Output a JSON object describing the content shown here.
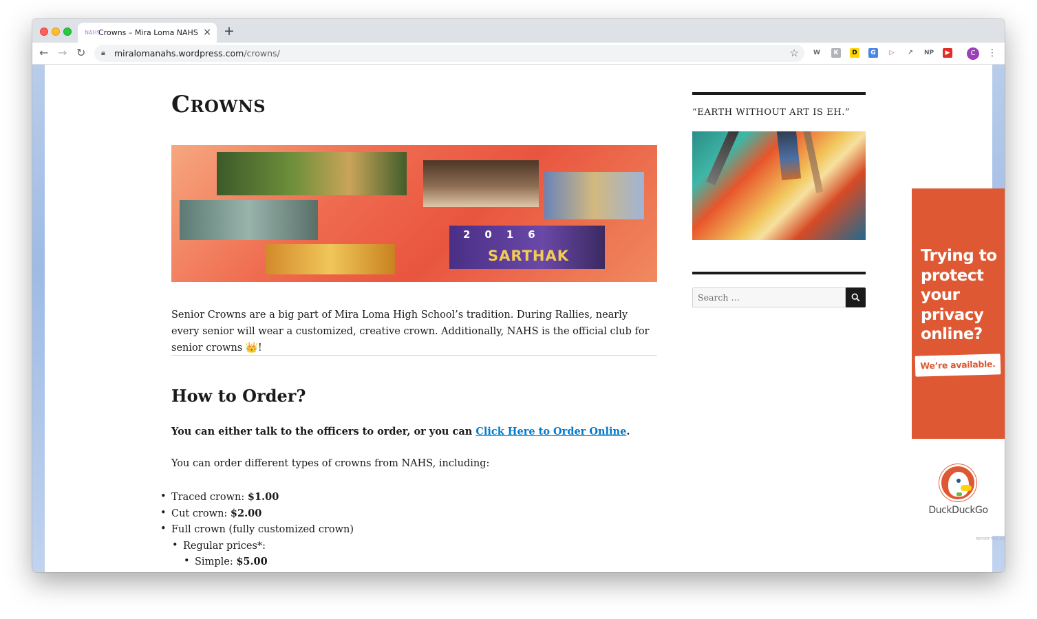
{
  "browser": {
    "tab_title": "Crowns – Mira Loma NAHS",
    "tab_favicon": "NAHS",
    "new_tab": "+",
    "tab_close": "×",
    "url_domain": "miralomanahs.wordpress.com",
    "url_path": "/crowns/",
    "avatar_letter": "C",
    "extensions": [
      {
        "name": "w-extension-icon",
        "glyph": "W",
        "color": "#5f6368",
        "bg": "#ffffff"
      },
      {
        "name": "k-extension-icon",
        "glyph": "K",
        "color": "#ffffff",
        "bg": "#b0b3b8"
      },
      {
        "name": "d-extension-icon",
        "glyph": "D",
        "color": "#111111",
        "bg": "#ffd600"
      },
      {
        "name": "translate-extension-icon",
        "glyph": "G",
        "color": "#ffffff",
        "bg": "#4a86e8"
      },
      {
        "name": "cast-extension-icon",
        "glyph": "▷",
        "color": "#e8453c",
        "bg": "#ffffff"
      },
      {
        "name": "share-extension-icon",
        "glyph": "↗",
        "color": "#5f6368",
        "bg": "#ffffff"
      },
      {
        "name": "np-extension-icon",
        "glyph": "NP",
        "color": "#5f6368",
        "bg": "#ffffff"
      },
      {
        "name": "youtube-extension-icon",
        "glyph": "▶",
        "color": "#ffffff",
        "bg": "#e52d27"
      }
    ]
  },
  "page": {
    "title": "Crowns",
    "banner_name": "SARTHAK",
    "banner_year": "2016",
    "intro": "Senior Crowns are a big part of Mira Loma High School’s tradition. During Rallies, nearly every senior will wear a customized, creative crown. Additionally, NAHS is the official club for senior crowns 👑!",
    "how_to_order_heading": "How to Order?",
    "order_text": "You can either talk to the officers to order, or you can ",
    "order_link": "Click Here to Order Online",
    "order_text_end": ".",
    "types_text": "You can order different types of crowns from NAHS, including:",
    "list": [
      {
        "level": 1,
        "label": "Traced crown: ",
        "price": "$1.00"
      },
      {
        "level": 1,
        "label": "Cut crown: ",
        "price": "$2.00"
      },
      {
        "level": 1,
        "label": "Full crown (fully customized crown)",
        "price": ""
      },
      {
        "level": 2,
        "label": "Regular prices*:",
        "price": ""
      },
      {
        "level": 3,
        "label": "Simple: ",
        "price": "$5.00"
      }
    ]
  },
  "sidebar": {
    "quote": "“EARTH WITHOUT ART IS EH.”",
    "search_placeholder": "Search …"
  },
  "ad": {
    "headline": "Trying to protect your privacy online?",
    "cta": "We’re available.",
    "brand": "DuckDuckGo",
    "report": "REPORT THIS AD",
    "accent": "#de5833"
  }
}
